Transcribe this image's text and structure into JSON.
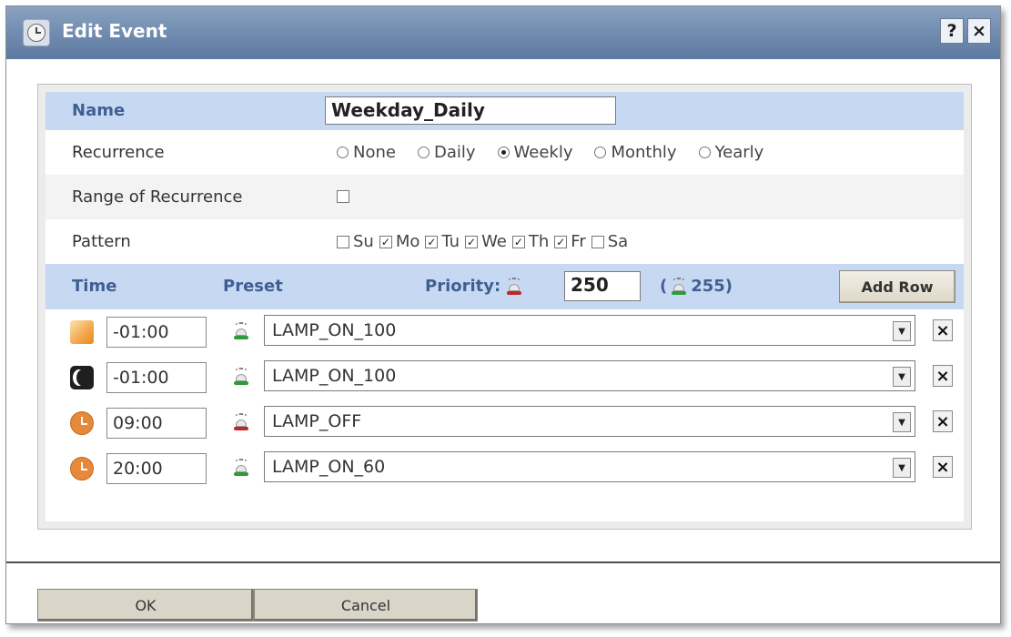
{
  "window": {
    "title": "Edit Event",
    "help_label": "?",
    "close_label": "×"
  },
  "form": {
    "name_label": "Name",
    "name_value": "Weekday_Daily",
    "recurrence_label": "Recurrence",
    "recurrence_options": [
      {
        "label": "None",
        "checked": false
      },
      {
        "label": "Daily",
        "checked": false
      },
      {
        "label": "Weekly",
        "checked": true
      },
      {
        "label": "Monthly",
        "checked": false
      },
      {
        "label": "Yearly",
        "checked": false
      }
    ],
    "range_label": "Range of Recurrence",
    "range_checked": false,
    "pattern_label": "Pattern",
    "days": [
      {
        "label": "Su",
        "checked": false
      },
      {
        "label": "Mo",
        "checked": true
      },
      {
        "label": "Tu",
        "checked": true
      },
      {
        "label": "We",
        "checked": true
      },
      {
        "label": "Th",
        "checked": true
      },
      {
        "label": "Fr",
        "checked": true
      },
      {
        "label": "Sa",
        "checked": false
      }
    ]
  },
  "table": {
    "time_header": "Time",
    "preset_header": "Preset",
    "priority_label": "Priority:",
    "priority_value": "250",
    "max_priority_open": "(",
    "max_priority": "255)",
    "add_row_label": "Add Row",
    "rows": [
      {
        "icon": "sunrise-icon",
        "time": "-01:00",
        "lamp": "green",
        "preset": "LAMP_ON_100"
      },
      {
        "icon": "moon-icon",
        "time": "-01:00",
        "lamp": "green",
        "preset": "LAMP_ON_100"
      },
      {
        "icon": "clock-icon",
        "time": "09:00",
        "lamp": "red",
        "preset": "LAMP_OFF"
      },
      {
        "icon": "clock-icon",
        "time": "20:00",
        "lamp": "green",
        "preset": "LAMP_ON_60"
      }
    ],
    "delete_label": "×"
  },
  "footer": {
    "ok_label": "OK",
    "cancel_label": "Cancel"
  },
  "colors": {
    "header_bg": "#c7d9f2",
    "header_text": "#3f5f93",
    "title_bar": "#6f8aae"
  }
}
